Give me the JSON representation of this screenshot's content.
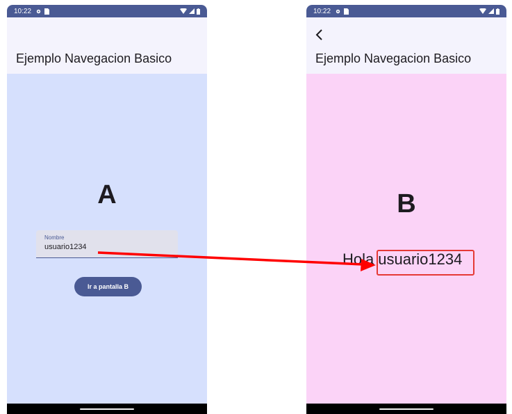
{
  "screen_a": {
    "status_time": "10:22",
    "title": "Ejemplo Navegacion Basico",
    "big_letter": "A",
    "field_label": "Nombre",
    "field_value": "usuario1234",
    "button_label": "Ir a pantalla B"
  },
  "screen_b": {
    "status_time": "10:22",
    "title": "Ejemplo Navegacion Basico",
    "big_letter": "B",
    "greeting_prefix": "Hola",
    "greeting_name": "usuario1234"
  },
  "colors": {
    "primary": "#4a5a94",
    "screen_a_background": "#d6e0fd",
    "screen_b_background": "#fbd3f7",
    "annotation": "#e53935"
  }
}
